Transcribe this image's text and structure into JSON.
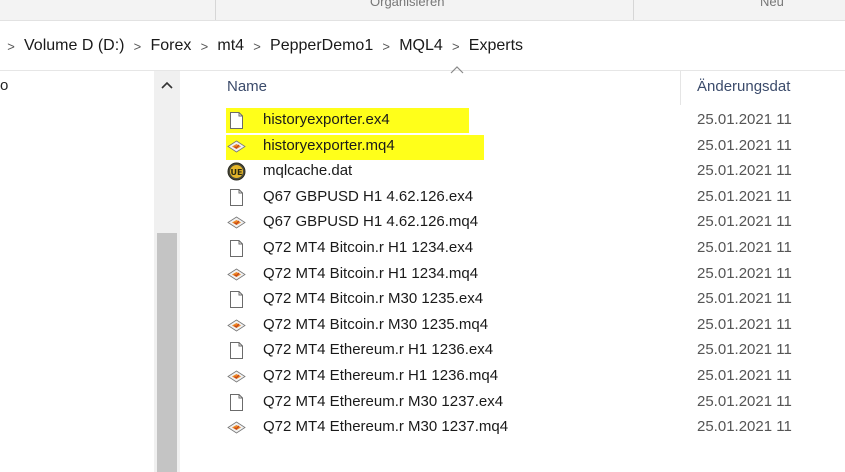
{
  "ribbon": {
    "organize_label": "Organisieren",
    "new_label": "Neu"
  },
  "breadcrumb": [
    "Volume D (D:)",
    "Forex",
    "mt4",
    "PepperDemo1",
    "MQL4",
    "Experts"
  ],
  "nav_pane": {
    "partial_text": "o"
  },
  "columns": {
    "name": "Name",
    "date": "Änderungsdat"
  },
  "files": [
    {
      "name": "historyexporter.ex4",
      "date": "25.01.2021 11",
      "icon": "blank-file-icon",
      "highlight": true
    },
    {
      "name": "historyexporter.mq4",
      "date": "25.01.2021 11",
      "icon": "mq4-file-icon",
      "highlight": true
    },
    {
      "name": "mqlcache.dat",
      "date": "25.01.2021 11",
      "icon": "ultraedit-icon",
      "highlight": false
    },
    {
      "name": "Q67 GBPUSD H1 4.62.126.ex4",
      "date": "25.01.2021 11",
      "icon": "blank-file-icon",
      "highlight": false
    },
    {
      "name": "Q67 GBPUSD H1 4.62.126.mq4",
      "date": "25.01.2021 11",
      "icon": "mq4-file-icon",
      "highlight": false
    },
    {
      "name": "Q72 MT4 Bitcoin.r H1 1234.ex4",
      "date": "25.01.2021 11",
      "icon": "blank-file-icon",
      "highlight": false
    },
    {
      "name": "Q72 MT4 Bitcoin.r H1 1234.mq4",
      "date": "25.01.2021 11",
      "icon": "mq4-file-icon",
      "highlight": false
    },
    {
      "name": "Q72 MT4 Bitcoin.r M30 1235.ex4",
      "date": "25.01.2021 11",
      "icon": "blank-file-icon",
      "highlight": false
    },
    {
      "name": "Q72 MT4 Bitcoin.r M30 1235.mq4",
      "date": "25.01.2021 11",
      "icon": "mq4-file-icon",
      "highlight": false
    },
    {
      "name": "Q72 MT4 Ethereum.r H1 1236.ex4",
      "date": "25.01.2021 11",
      "icon": "blank-file-icon",
      "highlight": false
    },
    {
      "name": "Q72 MT4 Ethereum.r H1 1236.mq4",
      "date": "25.01.2021 11",
      "icon": "mq4-file-icon",
      "highlight": false
    },
    {
      "name": "Q72 MT4 Ethereum.r M30 1237.ex4",
      "date": "25.01.2021 11",
      "icon": "blank-file-icon",
      "highlight": false
    },
    {
      "name": "Q72 MT4 Ethereum.r M30 1237.mq4",
      "date": "25.01.2021 11",
      "icon": "mq4-file-icon",
      "highlight": false
    }
  ],
  "colors": {
    "highlight": "#ffff1a",
    "scroll_thumb": "#c4c4c4"
  }
}
